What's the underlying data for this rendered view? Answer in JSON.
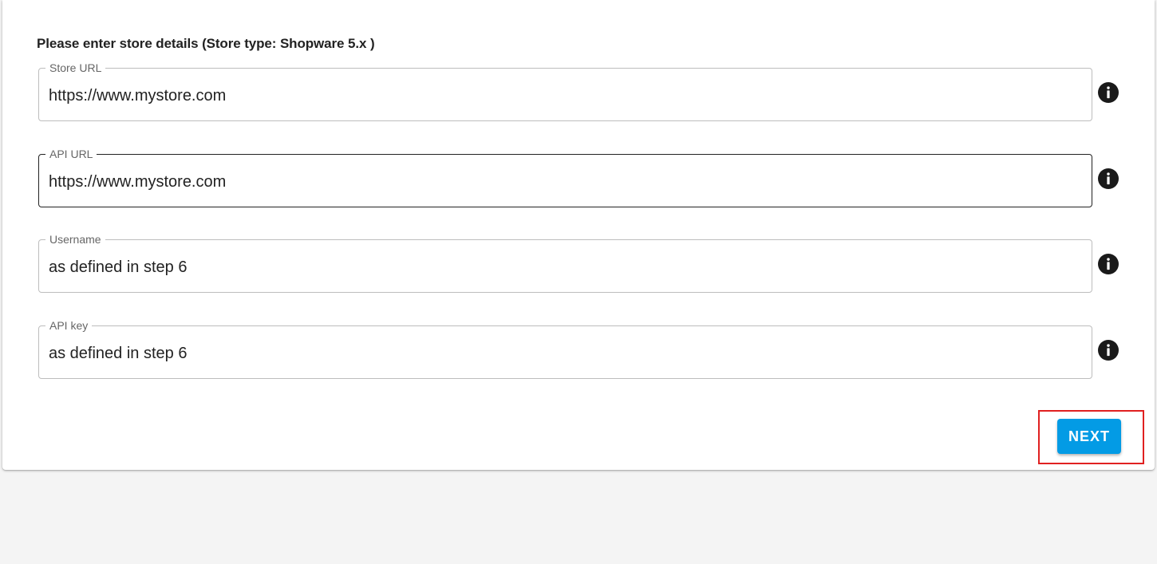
{
  "form": {
    "heading": "Please enter store details (Store type: Shopware 5.x )",
    "fields": [
      {
        "label": "Store URL",
        "value": "https://www.mystore.com",
        "icon": "info-icon"
      },
      {
        "label": "API URL",
        "value": "https://www.mystore.com",
        "icon": "info-icon"
      },
      {
        "label": "Username",
        "value": "as defined in step 6",
        "icon": "info-icon"
      },
      {
        "label": "API key",
        "value": "as defined in step 6",
        "icon": "info-icon"
      }
    ],
    "next_label": "NEXT"
  },
  "colors": {
    "accent": "#039be5",
    "highlight": "#e02020",
    "background": "#f4f4f4",
    "card": "#ffffff"
  }
}
